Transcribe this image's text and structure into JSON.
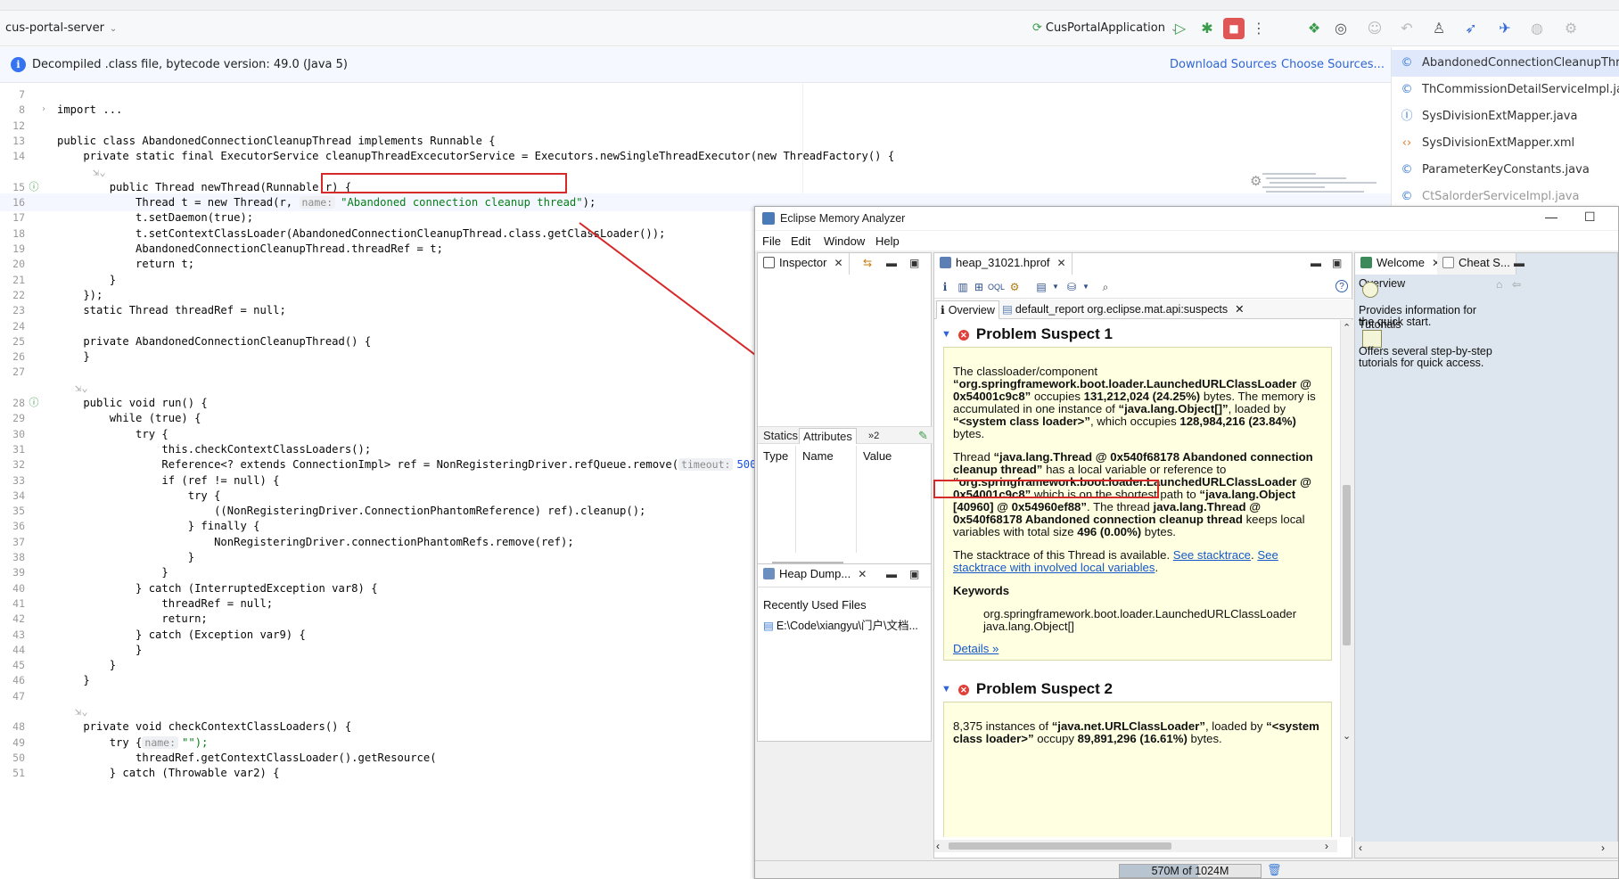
{
  "ide": {
    "project_name": "cus-portal-server",
    "run_config": "CusPortalApplication",
    "banner_message": "Decompiled .class file, bytecode version: 49.0 (Java 5)",
    "download_sources": "Download Sources",
    "choose_sources": "Choose Sources..."
  },
  "file_list": [
    {
      "name": "AbandonedConnectionCleanupThread",
      "icon": "class-icon",
      "active": true
    },
    {
      "name": "ThCommissionDetailServiceImpl.java",
      "icon": "class-icon"
    },
    {
      "name": "SysDivisionExtMapper.java",
      "icon": "interface-icon"
    },
    {
      "name": "SysDivisionExtMapper.xml",
      "icon": "xml-icon"
    },
    {
      "name": "ParameterKeyConstants.java",
      "icon": "class-icon"
    },
    {
      "name": "CtSalorderServiceImpl.java",
      "icon": "class-icon"
    }
  ],
  "code": {
    "hint_name": "name:",
    "hint_timeout": "timeout:",
    "lines": [
      {
        "n": "7",
        "t": ""
      },
      {
        "n": "8",
        "t": "import ..."
      },
      {
        "n": "12",
        "t": ""
      },
      {
        "n": "13",
        "t": "public class AbandonedConnectionCleanupThread implements Runnable {"
      },
      {
        "n": "14",
        "t": "    private static final ExecutorService cleanupThreadExcecutorService = Executors.newSingleThreadExecutor(new ThreadFactory() {"
      },
      {
        "n": "",
        "t": ""
      },
      {
        "n": "15",
        "t": "        public Thread newThread(Runnable r) {"
      },
      {
        "n": "16",
        "t": "            Thread t = new Thread(r, "
      },
      {
        "n": "17",
        "t": "            t.setDaemon(true);"
      },
      {
        "n": "18",
        "t": "            t.setContextClassLoader(AbandonedConnectionCleanupThread.class.getClassLoader());"
      },
      {
        "n": "19",
        "t": "            AbandonedConnectionCleanupThread.threadRef = t;"
      },
      {
        "n": "20",
        "t": "            return t;"
      },
      {
        "n": "21",
        "t": "        }"
      },
      {
        "n": "22",
        "t": "    });"
      },
      {
        "n": "23",
        "t": "    static Thread threadRef = null;"
      },
      {
        "n": "24",
        "t": ""
      },
      {
        "n": "25",
        "t": "    private AbandonedConnectionCleanupThread() {"
      },
      {
        "n": "26",
        "t": "    }"
      },
      {
        "n": "27",
        "t": ""
      },
      {
        "n": "",
        "t": ""
      },
      {
        "n": "28",
        "t": "    public void run() {"
      },
      {
        "n": "29",
        "t": "        while (true) {"
      },
      {
        "n": "30",
        "t": "            try {"
      },
      {
        "n": "31",
        "t": "                this.checkContextClassLoaders();"
      },
      {
        "n": "32",
        "t": "                Reference<? extends ConnectionImpl> ref = NonRegisteringDriver.refQueue.remove("
      },
      {
        "n": "33",
        "t": "                if (ref != null) {"
      },
      {
        "n": "34",
        "t": "                    try {"
      },
      {
        "n": "35",
        "t": "                        ((NonRegisteringDriver.ConnectionPhantomReference) ref).cleanup();"
      },
      {
        "n": "36",
        "t": "                    } finally {"
      },
      {
        "n": "37",
        "t": "                        NonRegisteringDriver.connectionPhantomRefs.remove(ref);"
      },
      {
        "n": "38",
        "t": "                    }"
      },
      {
        "n": "39",
        "t": "                }"
      },
      {
        "n": "40",
        "t": "            } catch (InterruptedException var8) {"
      },
      {
        "n": "41",
        "t": "                threadRef = null;"
      },
      {
        "n": "42",
        "t": "                return;"
      },
      {
        "n": "43",
        "t": "            } catch (Exception var9) {"
      },
      {
        "n": "44",
        "t": "            }"
      },
      {
        "n": "45",
        "t": "        }"
      },
      {
        "n": "46",
        "t": "    }"
      },
      {
        "n": "47",
        "t": ""
      },
      {
        "n": "",
        "t": ""
      },
      {
        "n": "48",
        "t": "    private void checkContextClassLoaders() {"
      },
      {
        "n": "49",
        "t": "        try {"
      },
      {
        "n": "50",
        "t": "            threadRef.getContextClassLoader().getResource("
      },
      {
        "n": "51",
        "t": "        } catch (Throwable var2) {"
      }
    ],
    "thread_name_literal": "\"Abandoned connection cleanup thread\"",
    "timeout_value": "5000L",
    "line32_tail": ");",
    "line50_tail": "\"\");"
  },
  "mat": {
    "window_title": "Eclipse Memory Analyzer",
    "menu": [
      "File",
      "Edit",
      "Window",
      "Help"
    ],
    "inspector_tab": "Inspector",
    "inspector_tabs": [
      "Statics",
      "Attributes"
    ],
    "inspector_more": "»2",
    "inspector_columns": [
      "Type",
      "Name",
      "Value"
    ],
    "heap_history_tab": "Heap Dump...",
    "recently_used": "Recently Used Files",
    "recent_file": "E:\\Code\\xiangyu\\门户\\文档...",
    "heap_tab": "heap_31021.hprof",
    "subtab_overview": "Overview",
    "subtab_report": "default_report org.eclipse.mat.api:suspects",
    "welcome_tab": "Welcome",
    "cheat_tab": "Cheat S...",
    "welcome_overview": "Overview",
    "welcome_overview_desc": "Provides information for the quick start.",
    "welcome_tutorials": "Tutorials",
    "welcome_tutorials_desc": "Offers several step-by-step tutorials for quick access.",
    "memory_status": "570M of 1024M",
    "memory_used_fraction": 0.557,
    "suspect1": {
      "title": "Problem Suspect 1",
      "p1_a": "The classloader/component ",
      "p1_b": "“org.springframework.boot.loader.LaunchedURLClassLoader @ 0x54001c9c8”",
      "p1_c": " occupies ",
      "p1_d": "131,212,024 (24.25%)",
      "p1_e": " bytes. The memory is accumulated in one instance of ",
      "p1_f": "“java.lang.Object[]”",
      "p1_g": ", loaded by ",
      "p1_h": "“<system class loader>”",
      "p1_i": ", which occupies ",
      "p1_j": "128,984,216 (23.84%)",
      "p1_k": " bytes.",
      "p2_a": "Thread ",
      "p2_b": "“java.lang.Thread @ 0x540f68178 Abandoned connection cleanup thread”",
      "p2_c": " has a local variable or reference to ",
      "p2_d": "“org.springframework.boot.loader.LaunchedURLClassLoader @ 0x54001c9c8”",
      "p2_e": " which is on the shortest path to ",
      "p2_f": "“java.lang.Object [40960] @ 0x54960ef88”",
      "p2_g": ". The thread ",
      "p2_h": "java.lang.Thread @ 0x540f68178 Abandoned connection cleanup thread",
      "p2_i": " keeps local variables with total size ",
      "p2_j": "496 (0.00%)",
      "p2_k": " bytes.",
      "p3_a": "The stacktrace of this Thread is available. ",
      "p3_link1": "See stacktrace",
      "p3_b": ". ",
      "p3_link2": "See stacktrace with involved local variables",
      "p3_c": ".",
      "keywords_title": "Keywords",
      "keyword1": "org.springframework.boot.loader.LaunchedURLClassLoader",
      "keyword2": "java.lang.Object[]",
      "details": "Details »"
    },
    "suspect2": {
      "title": "Problem Suspect 2",
      "p1_a": "8,375 instances of ",
      "p1_b": "“java.net.URLClassLoader”",
      "p1_c": ", loaded by ",
      "p1_d": "“<system class loader>”",
      "p1_e": " occupy ",
      "p1_f": "89,891,296 (16.61%)",
      "p1_g": " bytes."
    }
  },
  "colors": {
    "annotation_red": "#d62a2a",
    "link_blue": "#1558c9",
    "suspect_bg": "#ffffe1"
  }
}
